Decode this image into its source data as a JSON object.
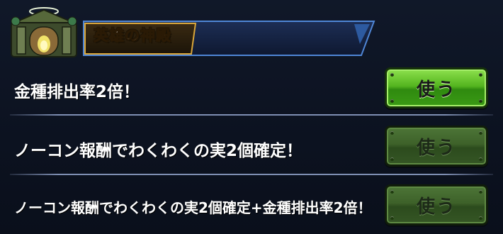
{
  "header": {
    "title": "英雄の神殿",
    "icon": "temple-icon"
  },
  "rows": [
    {
      "text": "金種排出率2倍！",
      "button_label": "使う",
      "button_state": "active"
    },
    {
      "text": "ノーコン報酬でわくわくの実2個確定！",
      "button_label": "使う",
      "button_state": "disabled"
    },
    {
      "text": "ノーコン報酬でわくわくの実2個確定+金種排出率2倍！",
      "button_label": "使う",
      "button_state": "disabled"
    }
  ],
  "colors": {
    "background": "#0d1322",
    "button_active": "#54b51f",
    "button_disabled": "#3d6129",
    "divider": "#7f8fb3"
  }
}
